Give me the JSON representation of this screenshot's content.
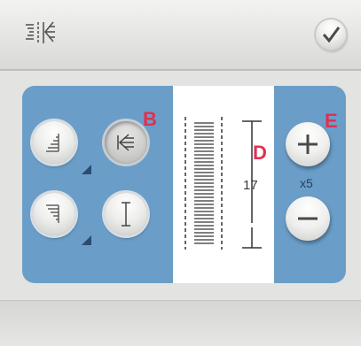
{
  "toolbar": {
    "mode_icon": "mirror-side-to-side-icon",
    "confirm_icon": "checkmark-icon"
  },
  "markers": {
    "b": "B",
    "d": "D",
    "e": "E"
  },
  "stitch": {
    "length_value": "17"
  },
  "adjust": {
    "multiplier": "x5",
    "plus_icon": "plus-icon",
    "minus_icon": "minus-icon"
  },
  "colors": {
    "panel": "#6a9ec9",
    "marker": "#e03050"
  }
}
